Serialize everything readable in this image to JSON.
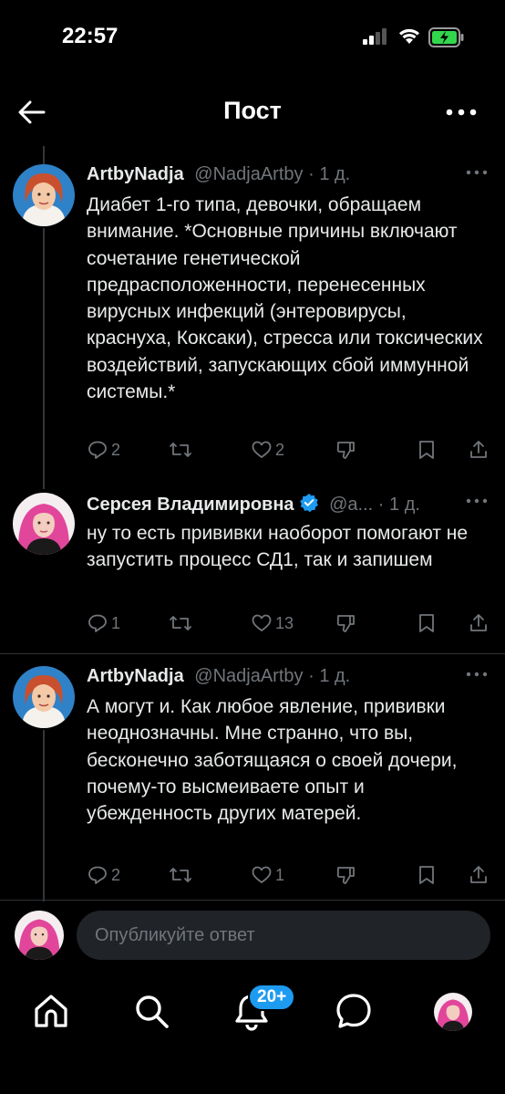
{
  "status_bar": {
    "time": "22:57"
  },
  "header": {
    "title": "Пост"
  },
  "posts": [
    {
      "author": "ArtbyNadja",
      "handle": "@NadjaArtby",
      "separator": "·",
      "age": "1 д.",
      "text": "Диабет 1-го типа, девочки, обращаем внимание. *Основные причины включают сочетание генетической предрасположенности, перенесенных вирусных инфекций (энтеровирусы, краснуха, Коксаки), стресса или токсических воздействий, запускающих сбой иммунной системы.*",
      "replies": "2",
      "reposts": "",
      "likes": "2"
    },
    {
      "author": "Серсея Владимировна",
      "handle": "@a...",
      "separator": "·",
      "age": "1 д.",
      "verified": true,
      "text": "ну то есть прививки наоборот помогают не запустить процесс СД1, так и запишем",
      "replies": "1",
      "reposts": "",
      "likes": "13"
    },
    {
      "author": "ArtbyNadja",
      "handle": "@NadjaArtby",
      "separator": "·",
      "age": "1 д.",
      "text": "А могут и. Как любое явление, прививки неоднозначны. Мне странно, что вы, бесконечно заботящаяся о своей дочери, почему-то высмеиваете опыт и убежденность других матерей.",
      "replies": "2",
      "reposts": "",
      "likes": "1"
    }
  ],
  "reply_box": {
    "placeholder": "Опубликуйте ответ"
  },
  "tab_bar": {
    "items": [
      "home-icon",
      "search-icon",
      "notifications-icon",
      "messages-icon",
      "profile-avatar"
    ],
    "notifications_badge": "20+"
  },
  "colors": {
    "accent": "#1d9bf0",
    "background": "#000000",
    "secondary_text": "#71767b"
  }
}
